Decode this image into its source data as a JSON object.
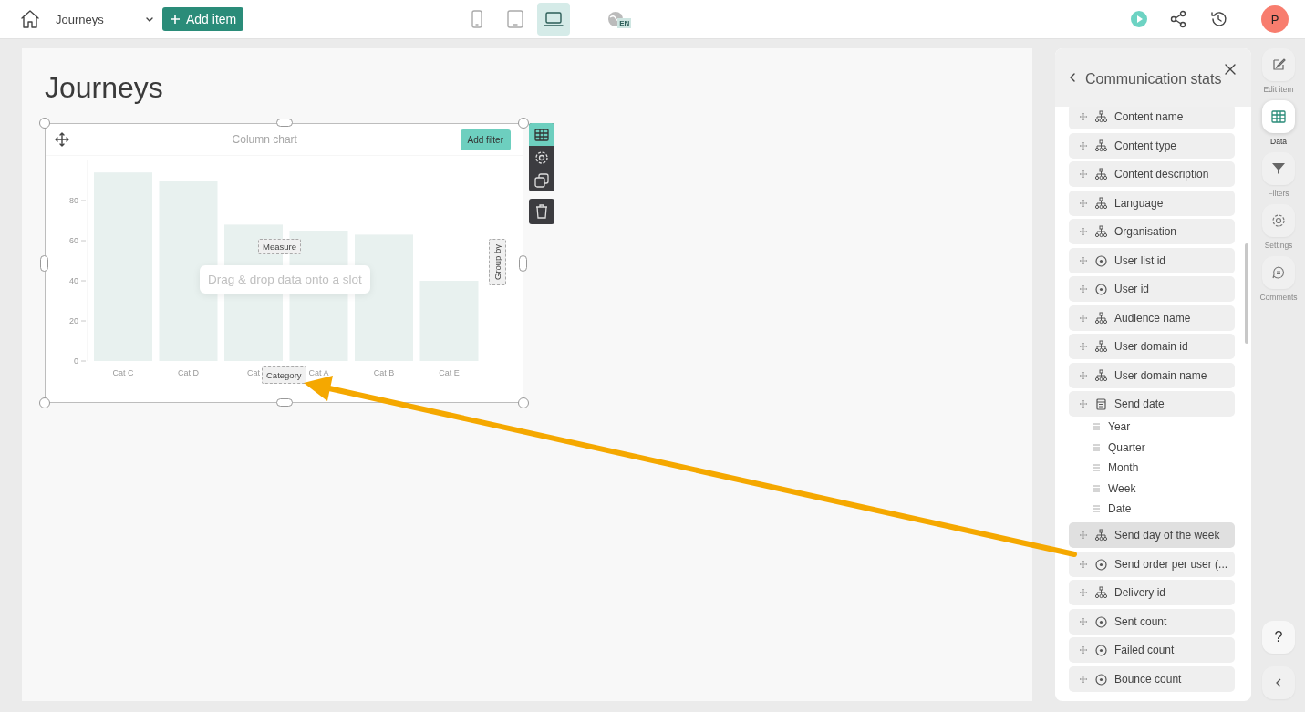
{
  "top_bar": {
    "dashboard_select": "Journeys",
    "add_button": "Add item",
    "devices": [
      {
        "kind": "phone",
        "selected": false
      },
      {
        "kind": "tablet",
        "selected": false
      },
      {
        "kind": "laptop",
        "selected": true
      }
    ],
    "language": "EN",
    "avatar": "P"
  },
  "canvas": {
    "title": "Journeys",
    "widget": {
      "add_filter": "Add filter",
      "measure_slot": "Measure",
      "group_by_slot": "Group by",
      "category_slot": "Category",
      "hint": "Drag & drop data onto a slot",
      "chart_data": {
        "type": "bar",
        "title": "Column chart",
        "categories": [
          "Cat C",
          "Cat D",
          "Cat",
          "Cat A",
          "Cat B",
          "Cat E"
        ],
        "values": [
          94,
          90,
          68,
          65,
          63,
          40
        ],
        "ylim": [
          0,
          100
        ],
        "yticks": [
          0,
          20,
          40,
          60,
          80
        ]
      }
    }
  },
  "data_panel": {
    "title": "Communication stats",
    "fields": [
      {
        "label": "Content name",
        "kind": "dimension",
        "selected": false
      },
      {
        "label": "Content type",
        "kind": "dimension",
        "selected": false
      },
      {
        "label": "Content description",
        "kind": "dimension",
        "selected": false
      },
      {
        "label": "Language",
        "kind": "dimension",
        "selected": false
      },
      {
        "label": "Organisation",
        "kind": "dimension",
        "selected": false
      },
      {
        "label": "User list id",
        "kind": "measure",
        "selected": false
      },
      {
        "label": "User id",
        "kind": "measure",
        "selected": false
      },
      {
        "label": "Audience name",
        "kind": "dimension",
        "selected": false
      },
      {
        "label": "User domain id",
        "kind": "dimension",
        "selected": false
      },
      {
        "label": "User domain name",
        "kind": "dimension",
        "selected": false
      },
      {
        "label": "Send date",
        "kind": "date",
        "selected": false,
        "children": [
          {
            "label": "Year"
          },
          {
            "label": "Quarter"
          },
          {
            "label": "Month"
          },
          {
            "label": "Week"
          },
          {
            "label": "Date"
          }
        ]
      },
      {
        "label": "Send day of the week",
        "kind": "dimension",
        "selected": true
      },
      {
        "label": "Send order per user (...",
        "kind": "measure",
        "selected": false
      },
      {
        "label": "Delivery id",
        "kind": "dimension",
        "selected": false
      },
      {
        "label": "Sent count",
        "kind": "measure",
        "selected": false
      },
      {
        "label": "Failed count",
        "kind": "measure",
        "selected": false
      },
      {
        "label": "Bounce count",
        "kind": "measure",
        "selected": false
      }
    ]
  },
  "side_rail": {
    "items": [
      {
        "label": "Edit item",
        "kind": "edit",
        "selected": false
      },
      {
        "label": "Data",
        "kind": "data",
        "selected": true
      },
      {
        "label": "Filters",
        "kind": "filter",
        "selected": false
      },
      {
        "label": "Settings",
        "kind": "settings",
        "selected": false
      },
      {
        "label": "Comments",
        "kind": "comments",
        "selected": false
      }
    ],
    "help": "?"
  }
}
